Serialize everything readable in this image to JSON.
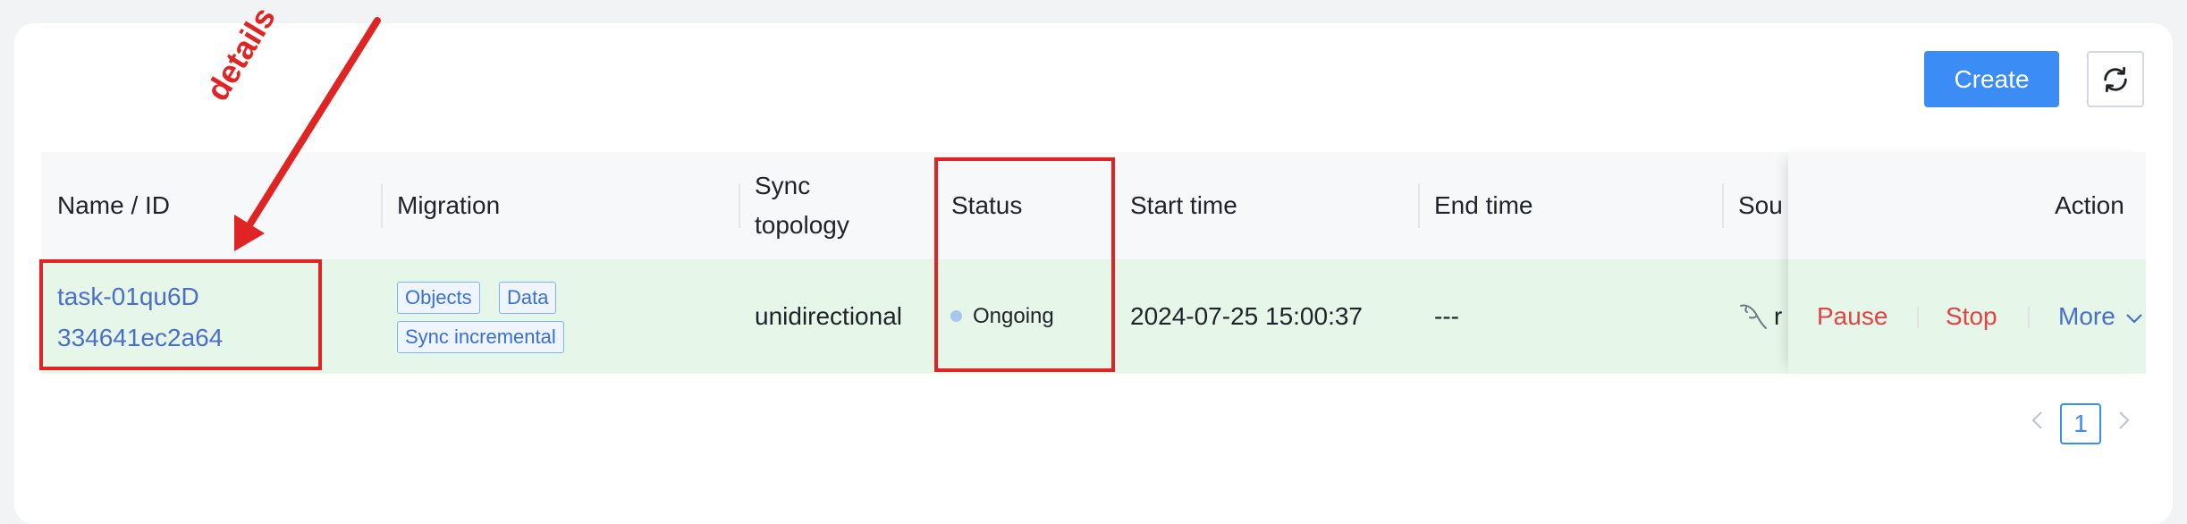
{
  "toolbar": {
    "create_label": "Create",
    "refresh_icon": "refresh-icon"
  },
  "table": {
    "columns": [
      "Name / ID",
      "Migration",
      "Sync topology",
      "Status",
      "Start time",
      "End time",
      "Sou",
      "Action"
    ],
    "sync_topology_lines": [
      "Sync",
      "topology"
    ],
    "row": {
      "name": "task-01qu6D",
      "id": "334641ec2a64",
      "migration_tags": [
        "Objects",
        "Data",
        "Sync incremental"
      ],
      "sync_topology": "unidirectional",
      "status": "Ongoing",
      "start_time": "2024-07-25 15:00:37",
      "end_time": "---",
      "source_partial": "r",
      "source_icon": "mysql-icon",
      "actions": {
        "pause": "Pause",
        "stop": "Stop",
        "more": "More"
      }
    }
  },
  "pagination": {
    "current_page": "1"
  },
  "annotation": {
    "label": "details",
    "color": "#e02424"
  },
  "colors": {
    "primary": "#3b8cf5",
    "danger": "#e04444",
    "link": "#4a6fc7",
    "row_highlight": "#e6f6e8"
  }
}
